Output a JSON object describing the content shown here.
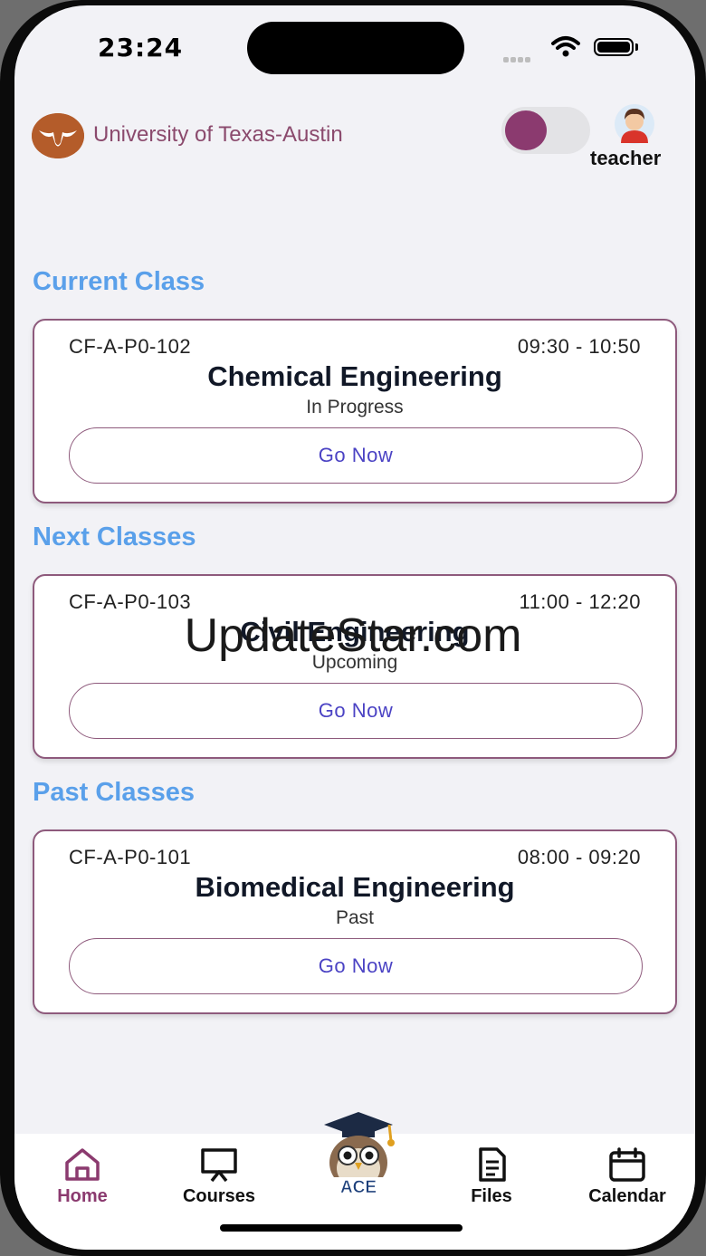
{
  "status_bar": {
    "time": "23:24"
  },
  "header": {
    "university": "University of Texas-Austin",
    "role": "teacher"
  },
  "sections": {
    "current": "Current Class",
    "next": "Next Classes",
    "past": "Past Classes"
  },
  "classes": [
    {
      "code": "CF-A-P0-102",
      "time": "09:30 - 10:50",
      "title": "Chemical Engineering",
      "status": "In Progress",
      "button": "Go Now"
    },
    {
      "code": "CF-A-P0-103",
      "time": "11:00 - 12:20",
      "title": "Civil Engineering",
      "status": "Upcoming",
      "button": "Go Now"
    },
    {
      "code": "CF-A-P0-101",
      "time": "08:00 - 09:20",
      "title": "Biomedical Engineering",
      "status": "Past",
      "button": "Go Now"
    }
  ],
  "watermark": "UpdateStar.com",
  "tabbar": {
    "home": "Home",
    "courses": "Courses",
    "center": "ACE",
    "files": "Files",
    "calendar": "Calendar"
  },
  "colors": {
    "accent": "#8b3a6f",
    "section_heading": "#5aa0ea",
    "button_text": "#4b43c4",
    "card_border": "#8e5a7c"
  },
  "icons": {
    "home": "home-icon",
    "courses": "presentation-board-icon",
    "files": "document-icon",
    "calendar": "calendar-icon",
    "center": "owl-mascot-icon"
  }
}
